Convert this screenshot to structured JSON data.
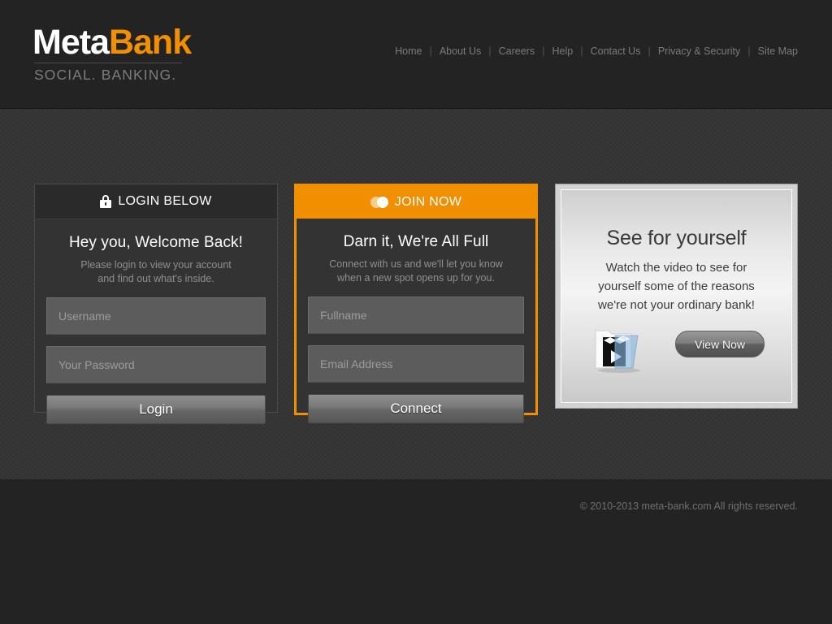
{
  "header": {
    "logo": {
      "part1": "Meta",
      "part2": "Bank",
      "tagline": "SOCIAL. BANKING.",
      "accent_color": "#f18f00"
    },
    "nav": {
      "items": [
        {
          "label": "Home"
        },
        {
          "label": "About Us"
        },
        {
          "label": "Careers"
        },
        {
          "label": "Help"
        },
        {
          "label": "Contact Us"
        },
        {
          "label": "Privacy & Security"
        },
        {
          "label": "Site Map"
        }
      ],
      "separator": "|"
    }
  },
  "login_panel": {
    "header_label": "LOGIN BELOW",
    "header_icon": "lock-icon",
    "title": "Hey you, Welcome Back!",
    "subtitle_line1": "Please login to view your account",
    "subtitle_line2": "and find out what's inside.",
    "username_placeholder": "Username",
    "username_value": "",
    "password_placeholder": "Your Password",
    "password_value": "",
    "submit_label": "Login"
  },
  "join_panel": {
    "header_label": "JOIN NOW",
    "header_icon": "people-icon",
    "header_color": "#f18f00",
    "title": "Darn it, We're All Full",
    "subtitle_line1": "Connect with us and we'll let you know",
    "subtitle_line2": "when a new spot opens up for you.",
    "fullname_placeholder": "Fullname",
    "fullname_value": "",
    "email_placeholder": "Email Address",
    "email_value": "",
    "submit_label": "Connect"
  },
  "video_panel": {
    "title": "See for yourself",
    "desc_line1": "Watch the video to see for",
    "desc_line2": "yourself some of the reasons",
    "desc_line3": "we're not your ordinary bank!",
    "icon": "video-clapperboard-icon",
    "button_label": "View Now"
  },
  "footer": {
    "copyright": "© 2010-2013 meta-bank.com All rights reserved."
  }
}
